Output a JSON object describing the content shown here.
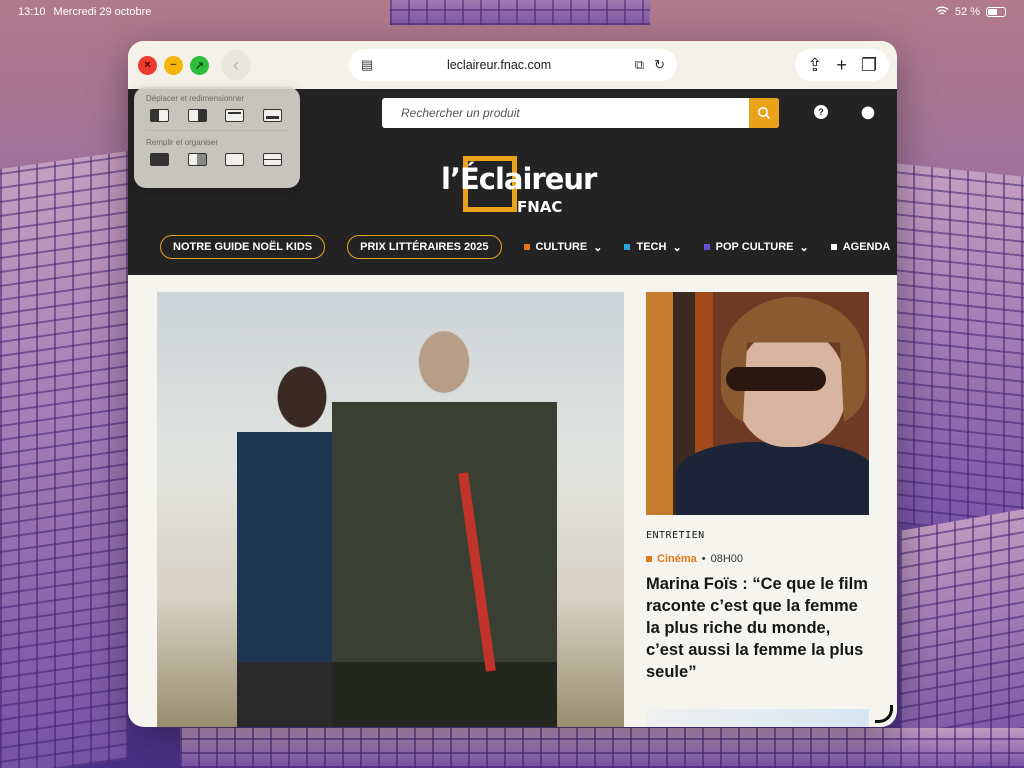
{
  "status_bar": {
    "time": "13:10",
    "date": "Mercredi 29 octobre",
    "battery": "52 %"
  },
  "browser": {
    "url": "leclaireur.fnac.com",
    "controls": {
      "close": "×",
      "minimize": "−",
      "maximize": "↗"
    }
  },
  "window_menu": {
    "section1_title": "Déplacer et redimensionner",
    "section2_title": "Remplir et organiser"
  },
  "site": {
    "search_placeholder": "Rechercher un produit",
    "logo_text": "l’Éclaireur",
    "logo_sub": "FNAC",
    "nav": {
      "pill1": "NOTRE GUIDE NOËL KIDS",
      "pill2": "PRIX LITTÉRAIRES 2025",
      "items": [
        {
          "label": "CULTURE",
          "color": "#e8731a",
          "has_dropdown": true
        },
        {
          "label": "TECH",
          "color": "#2aa6df",
          "has_dropdown": true
        },
        {
          "label": "POP CULTURE",
          "color": "#6a4fd6",
          "has_dropdown": true
        },
        {
          "label": "AGENDA",
          "color": "#ffffff",
          "has_dropdown": false
        }
      ]
    }
  },
  "article": {
    "kicker": "ENTRETIEN",
    "category": "Cinéma",
    "time": "08H00",
    "headline": "Marina Foïs : “Ce que le film raconte c’est que la femme la plus riche du monde, c’est aussi la femme la plus seule”"
  },
  "colors": {
    "accent": "#e9a21a",
    "header_bg": "#232323",
    "page_bg": "#f6f4ee"
  }
}
